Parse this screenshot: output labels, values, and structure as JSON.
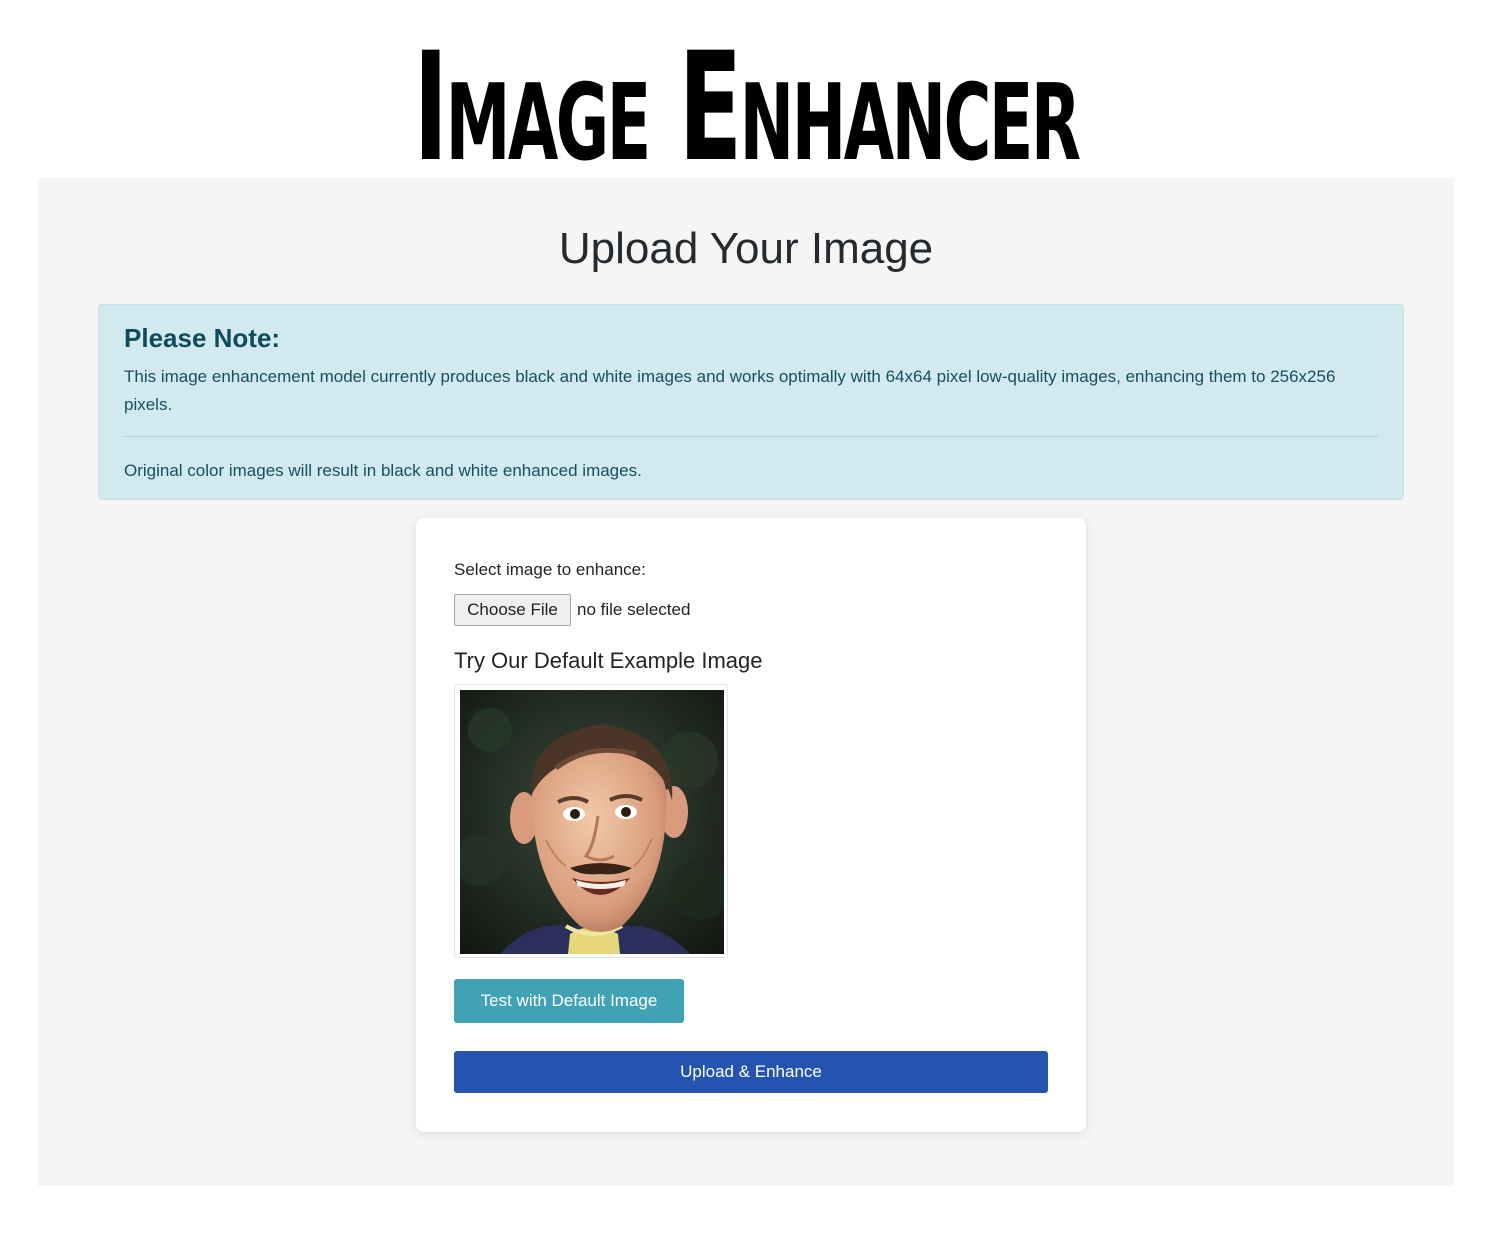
{
  "header": {
    "brand_title": "Image Enhancer"
  },
  "main": {
    "heading": "Upload Your Image"
  },
  "note": {
    "heading": "Please Note:",
    "text": "This image enhancement model currently produces black and white images and works optimally with 64x64 pixel low-quality images, enhancing them to 256x256 pixels.",
    "secondary_text": "Original color images will result in black and white enhanced images."
  },
  "upload_form": {
    "select_label": "Select image to enhance:",
    "file_button_label": "Choose File",
    "file_status": "no file selected",
    "example_heading": "Try Our Default Example Image",
    "test_button_label": "Test with Default Image",
    "submit_button_label": "Upload & Enhance"
  },
  "colors": {
    "panel_background": "#f5f5f5",
    "alert_background": "#d2e9ef",
    "alert_text": "#0f4b5a",
    "test_button": "#3fa2b5",
    "primary_button": "#2454b0"
  },
  "icons": {
    "example_image": "portrait-photo"
  }
}
